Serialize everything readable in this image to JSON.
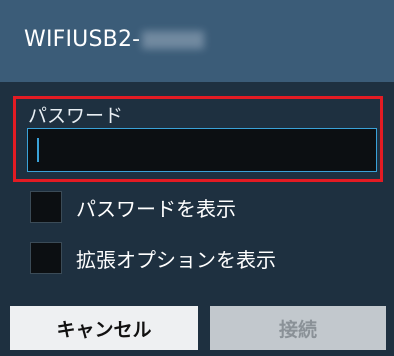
{
  "dialog": {
    "title": "WIFIUSB2-",
    "password_label": "パスワード",
    "password_value": "",
    "show_password_label": "パスワードを表示",
    "advanced_options_label": "拡張オプションを表示",
    "cancel_label": "キャンセル",
    "connect_label": "接続"
  },
  "colors": {
    "title_bar": "#3b5c78",
    "dialog_bg": "#1e3040",
    "highlight_border": "#e31b23",
    "input_focus": "#3aa2d8"
  }
}
